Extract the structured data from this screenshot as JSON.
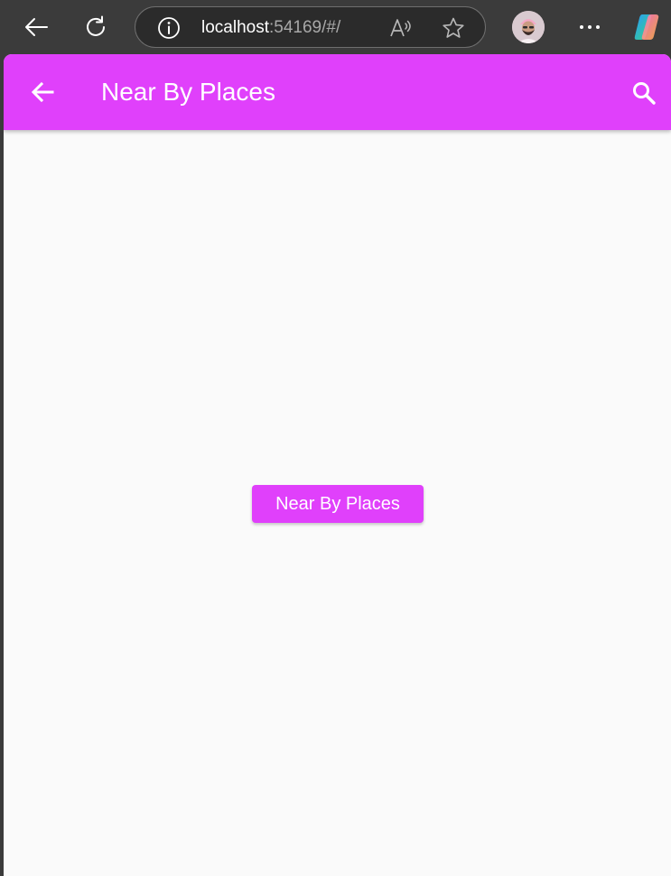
{
  "browser": {
    "url_host": "localhost",
    "url_rest": ":54169/#/",
    "icons": {
      "back": "back-arrow-icon",
      "reload": "reload-icon",
      "info": "info-icon",
      "read_aloud": "read-aloud-icon",
      "favorite": "star-icon",
      "profile": "avatar",
      "menu": "more-icon",
      "copilot": "copilot-icon"
    }
  },
  "app": {
    "title": "Near By Places",
    "colors": {
      "primary": "#e040fb",
      "background": "#fafafa",
      "on_primary": "#ffffff"
    },
    "icons": {
      "back": "arrow-back-icon",
      "search": "search-icon"
    },
    "button_label": "Near By Places"
  }
}
